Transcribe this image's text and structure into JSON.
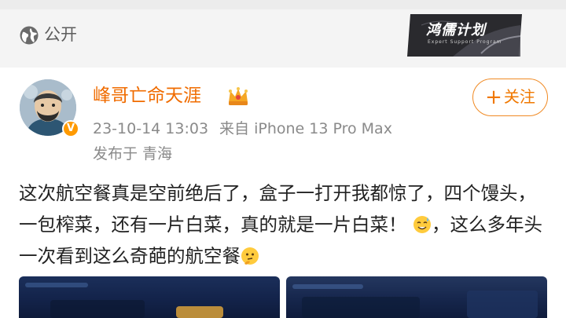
{
  "header": {
    "visibility_icon": "globe-icon",
    "visibility_label": "公开"
  },
  "watermark": {
    "text": "鸿儒计划",
    "subtext": "Expert Support Program"
  },
  "post": {
    "author": {
      "name": "峰哥亡命天涯",
      "verified_badge": "V",
      "crown_icon": "crown-icon"
    },
    "timestamp": "23-10-14 13:03",
    "source": "来自 iPhone 13 Pro Max",
    "location": "发布于 青海",
    "follow_label": "关注",
    "follow_icon": "plus-icon",
    "text_part1": "这次航空餐真是空前绝后了，盒子一打开我都惊了，四个馒头，一包榨菜，还有一片白菜，真的就是一片白菜！",
    "text_part2": "，这么多年头一次看到这么奇葩的航空餐",
    "emoji_1": "sweat-smile-emoji",
    "emoji_2": "thinking-emoji"
  },
  "colors": {
    "accent": "#f07800",
    "username": "#f06c00",
    "meta_text": "#8a8a8a",
    "body_text": "#222222"
  }
}
